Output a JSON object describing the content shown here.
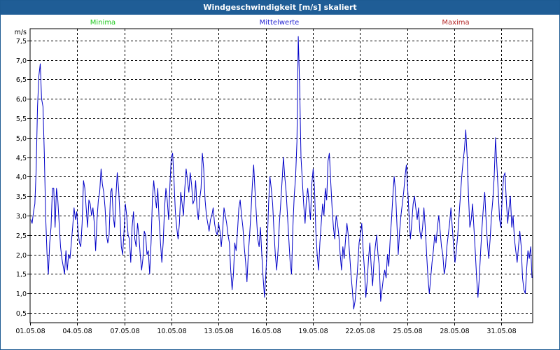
{
  "window": {
    "title": "Windgeschwindigkeit [m/s] skaliert"
  },
  "legend": [
    {
      "label": "Minima",
      "color": "#1ec81e"
    },
    {
      "label": "Mittelwerte",
      "color": "#2323d2"
    },
    {
      "label": "Maxima",
      "color": "#b42828"
    }
  ],
  "chart_data": {
    "type": "line",
    "title": "Windgeschwindigkeit [m/s] skaliert",
    "ylabel": "m/s",
    "xlabel": "",
    "ylim": [
      0.25,
      7.8
    ],
    "yticks": [
      "7,5",
      "7,0",
      "6,5",
      "6,0",
      "5,5",
      "5,0",
      "4,5",
      "4,0",
      "3,5",
      "3,0",
      "2,5",
      "2,0",
      "1,5",
      "1,0",
      "0,5"
    ],
    "xticks": [
      "01.05.08",
      "04.05.08",
      "07.05.08",
      "10.05.08",
      "13.05.08",
      "16.05.08",
      "19.05.08",
      "22.05.08",
      "25.05.08",
      "28.05.08",
      "31.05.08"
    ],
    "grid": true,
    "series": [
      {
        "name": "Mittelwerte",
        "color": "#0000c8",
        "start": "2008-05-01",
        "interval_hours": 6,
        "values": [
          2.9,
          2.8,
          3.1,
          3.3,
          4.2,
          5.8,
          6.6,
          6.9,
          6.0,
          5.8,
          4.6,
          3.0,
          2.0,
          1.5,
          2.3,
          2.7,
          3.7,
          3.7,
          2.7,
          3.7,
          3.4,
          2.8,
          2.2,
          1.9,
          1.7,
          1.5,
          2.1,
          1.6,
          2.0,
          1.9,
          2.3,
          2.7,
          3.2,
          2.9,
          3.1,
          2.6,
          2.3,
          2.2,
          2.8,
          3.9,
          3.7,
          3.2,
          2.7,
          3.4,
          3.3,
          3.0,
          3.2,
          2.8,
          2.1,
          2.9,
          3.4,
          3.6,
          4.2,
          3.8,
          3.6,
          3.2,
          2.5,
          2.3,
          2.5,
          3.6,
          3.7,
          3.0,
          2.7,
          3.5,
          4.1,
          3.7,
          3.0,
          2.2,
          2.0,
          2.6,
          3.3,
          3.0,
          2.5,
          2.4,
          1.8,
          2.7,
          3.1,
          2.4,
          2.2,
          2.8,
          2.5,
          2.0,
          1.6,
          1.9,
          2.6,
          2.5,
          2.0,
          2.1,
          1.5,
          2.3,
          3.4,
          3.9,
          3.5,
          3.2,
          3.7,
          2.9,
          2.3,
          1.8,
          2.3,
          3.2,
          3.7,
          3.4,
          2.9,
          3.8,
          4.5,
          4.6,
          3.9,
          3.1,
          2.7,
          2.4,
          2.8,
          3.6,
          3.3,
          3.0,
          3.7,
          4.2,
          3.9,
          3.6,
          4.1,
          3.8,
          3.3,
          3.4,
          3.9,
          3.2,
          2.9,
          3.4,
          3.7,
          4.6,
          4.2,
          3.4,
          3.0,
          2.8,
          2.6,
          2.9,
          3.0,
          3.2,
          2.8,
          2.6,
          2.5,
          2.8,
          2.6,
          2.2,
          2.6,
          3.2,
          3.0,
          2.8,
          2.5,
          2.3,
          1.6,
          1.1,
          1.5,
          2.3,
          2.1,
          2.6,
          3.2,
          3.4,
          3.0,
          2.7,
          2.2,
          1.8,
          1.3,
          2.0,
          2.5,
          3.1,
          3.8,
          4.3,
          3.6,
          3.0,
          2.4,
          2.2,
          2.7,
          2.0,
          1.4,
          0.9,
          1.5,
          2.2,
          3.3,
          4.0,
          3.7,
          3.3,
          2.6,
          2.0,
          1.6,
          2.1,
          2.8,
          3.3,
          3.9,
          4.5,
          4.0,
          3.6,
          3.0,
          2.4,
          1.8,
          1.5,
          2.7,
          3.5,
          4.0,
          4.9,
          7.6,
          6.3,
          4.5,
          3.9,
          3.3,
          2.8,
          3.4,
          3.7,
          3.3,
          2.9,
          3.8,
          4.2,
          3.7,
          2.6,
          2.0,
          1.6,
          2.3,
          2.8,
          3.3,
          3.0,
          3.7,
          3.4,
          4.4,
          4.6,
          3.9,
          3.2,
          2.7,
          2.4,
          3.0,
          2.8,
          2.5,
          2.0,
          1.6,
          2.2,
          1.9,
          2.4,
          2.8,
          2.5,
          2.0,
          1.5,
          1.1,
          0.6,
          0.8,
          1.2,
          1.7,
          2.3,
          2.5,
          2.8,
          2.1,
          1.6,
          0.9,
          1.3,
          1.9,
          2.3,
          1.7,
          1.2,
          1.8,
          2.2,
          2.5,
          2.0,
          1.7,
          0.8,
          1.1,
          1.4,
          1.6,
          1.4,
          2.0,
          1.7,
          2.4,
          2.9,
          3.5,
          4.0,
          3.6,
          2.8,
          2.0,
          2.6,
          3.0,
          3.3,
          3.6,
          4.0,
          4.3,
          3.7,
          3.0,
          2.4,
          2.8,
          3.3,
          3.5,
          3.2,
          2.9,
          3.2,
          2.6,
          2.4,
          2.7,
          3.2,
          2.7,
          2.0,
          1.4,
          1.0,
          1.4,
          1.8,
          2.1,
          2.5,
          2.3,
          2.7,
          3.0,
          2.6,
          2.2,
          2.0,
          1.5,
          1.7,
          2.2,
          2.5,
          2.8,
          3.2,
          2.7,
          2.2,
          1.8,
          2.1,
          2.5,
          3.0,
          3.5,
          4.0,
          4.4,
          4.7,
          5.2,
          4.5,
          3.5,
          2.7,
          2.9,
          3.3,
          2.7,
          2.1,
          1.4,
          0.9,
          1.4,
          2.1,
          2.7,
          3.2,
          3.6,
          2.9,
          2.3,
          1.9,
          2.4,
          3.0,
          3.4,
          4.0,
          5.0,
          4.3,
          3.6,
          2.9,
          2.7,
          3.5,
          4.0,
          4.1,
          3.4,
          2.8,
          3.2,
          3.5,
          2.7,
          3.0,
          2.4,
          2.1,
          1.8,
          2.2,
          2.6,
          2.2,
          1.4,
          1.1,
          1.0,
          1.6,
          2.1,
          1.9,
          2.2,
          1.4
        ]
      }
    ]
  }
}
